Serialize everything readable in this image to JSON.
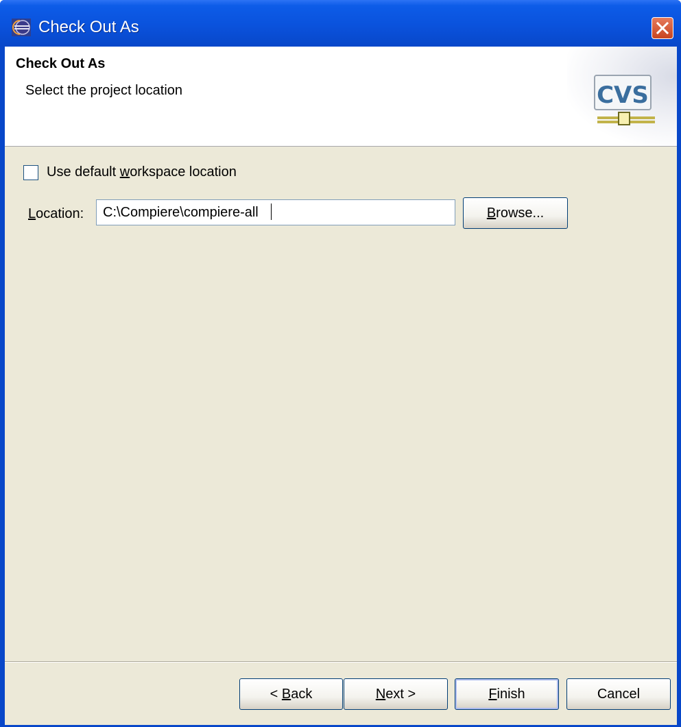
{
  "window": {
    "title": "Check Out As",
    "close_icon": "close-icon"
  },
  "banner": {
    "title": "Check Out As",
    "description": "Select the project location",
    "logo_text": "CVS"
  },
  "options": {
    "use_default": {
      "label_pre": "Use default ",
      "label_mnemonic": "w",
      "label_post": "orkspace location",
      "checked": false
    }
  },
  "location": {
    "label_mnemonic": "L",
    "label_post": "ocation:",
    "value": "C:\\Compiere\\compiere-all",
    "browse_mnemonic": "B",
    "browse_post": "rowse..."
  },
  "buttons": {
    "back_pre": "< ",
    "back_mnemonic": "B",
    "back_post": "ack",
    "next_mnemonic": "N",
    "next_post": "ext >",
    "finish_mnemonic": "F",
    "finish_post": "inish",
    "cancel": "Cancel"
  },
  "colors": {
    "titlebar": "#0a52dc",
    "dialog_bg": "#ece9d8",
    "button_border": "#003c74"
  }
}
